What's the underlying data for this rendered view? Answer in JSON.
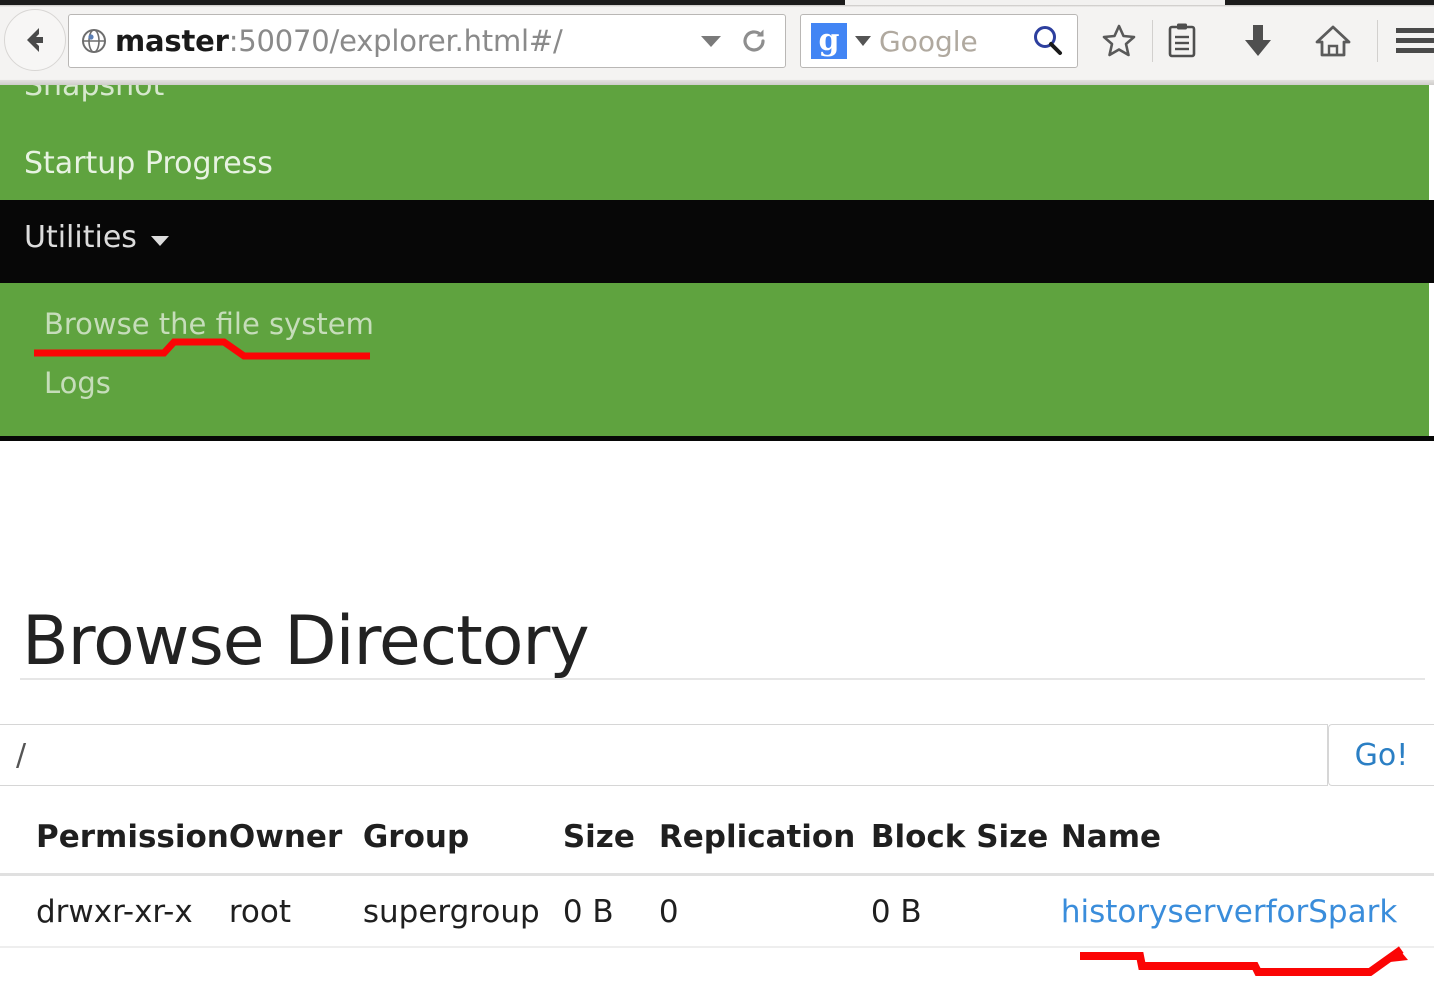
{
  "browser": {
    "back_tooltip": "Back",
    "url_host": "master",
    "url_rest": ":50070/explorer.html#/",
    "url_full": "master:50070/explorer.html#/",
    "reload_label": "Reload",
    "search_engine": "Google",
    "search_engine_badge": "g",
    "search_placeholder": "Google",
    "icons": {
      "globe": "globe-icon",
      "dropdown": "chevron-down-icon",
      "reload": "reload-icon",
      "search": "search-icon",
      "bookmark": "star-icon",
      "reader": "reader-list-icon",
      "downloads": "download-arrow-icon",
      "home": "home-icon",
      "menu": "hamburger-menu-icon"
    }
  },
  "navbar": {
    "items": [
      {
        "label": "Snapshot",
        "name": "nav-item-snapshot"
      },
      {
        "label": "Startup Progress",
        "name": "nav-item-startup-progress"
      }
    ],
    "utilities": {
      "label": "Utilities",
      "caret": "caret-down",
      "dropdown_items": [
        {
          "label": "Browse the file system",
          "name": "dropdown-item-browse-filesystem"
        },
        {
          "label": "Logs",
          "name": "dropdown-item-logs"
        }
      ]
    },
    "colors": {
      "green": "#5fa33f",
      "black": "#070707",
      "link_text": "#e8f3e2"
    }
  },
  "main": {
    "title": "Browse Directory",
    "path_value": "/",
    "path_placeholder": "",
    "go_label": "Go!",
    "table": {
      "headers": [
        "Permission",
        "Owner",
        "Group",
        "Size",
        "Replication",
        "Block Size",
        "Name"
      ],
      "rows": [
        {
          "permission": "drwxr-xr-x",
          "owner": "root",
          "group": "supergroup",
          "size": "0 B",
          "replication": "0",
          "block_size": "0 B",
          "name": "historyserverforSpark"
        }
      ]
    }
  },
  "annotations": {
    "color": "#fb0505",
    "marks": [
      {
        "name": "underline-browse-the-file-system",
        "target": "Browse the file system"
      },
      {
        "name": "underline-historyserverforspark",
        "target": "historyserverforSpark"
      }
    ]
  }
}
